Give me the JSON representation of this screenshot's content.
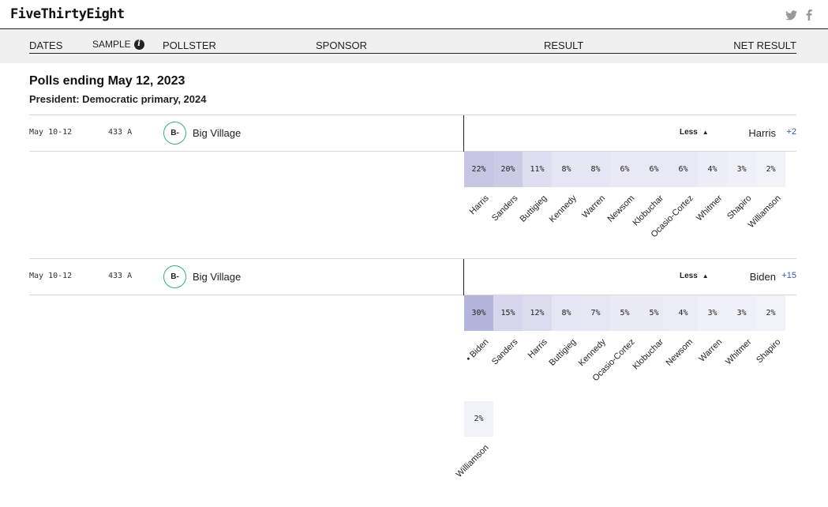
{
  "header": {
    "logo": "FiveThirtyEight",
    "social": [
      {
        "name": "twitter",
        "icon": "twitter-icon"
      },
      {
        "name": "facebook",
        "icon": "facebook-icon"
      }
    ]
  },
  "columns": {
    "dates": "DATES",
    "sample": "SAMPLE",
    "sample_info_icon": "info-icon",
    "pollster": "POLLSTER",
    "sponsor": "SPONSOR",
    "result": "RESULT",
    "net_result": "NET RESULT"
  },
  "group": {
    "title": "Polls ending May 12, 2023",
    "subtitle": "President: Democratic primary, 2024"
  },
  "colors": {
    "grade_ring": "#3aaa8c",
    "net_margin": "#3b55b9",
    "band": "#f0f0f0"
  },
  "polls": [
    {
      "dates": "May 10-12",
      "sample": "433 A",
      "grade": "B-",
      "pollster": "Big Village",
      "toggle": "Less",
      "leader": "Harris",
      "margin": "+2",
      "results": [
        {
          "name": "Harris",
          "pct": "22%",
          "value": 22
        },
        {
          "name": "Sanders",
          "pct": "20%",
          "value": 20
        },
        {
          "name": "Buttigieg",
          "pct": "11%",
          "value": 11
        },
        {
          "name": "Kennedy",
          "pct": "8%",
          "value": 8
        },
        {
          "name": "Warren",
          "pct": "8%",
          "value": 8
        },
        {
          "name": "Newsom",
          "pct": "6%",
          "value": 6
        },
        {
          "name": "Klobuchar",
          "pct": "6%",
          "value": 6
        },
        {
          "name": "Ocasio-Cortez",
          "pct": "6%",
          "value": 6
        },
        {
          "name": "Whitmer",
          "pct": "4%",
          "value": 4
        },
        {
          "name": "Shapiro",
          "pct": "3%",
          "value": 3
        },
        {
          "name": "Williamson",
          "pct": "2%",
          "value": 2
        }
      ]
    },
    {
      "dates": "May 10-12",
      "sample": "433 A",
      "grade": "B-",
      "pollster": "Big Village",
      "toggle": "Less",
      "leader": "Biden",
      "margin": "+15",
      "results": [
        {
          "name": "Biden",
          "pct": "30%",
          "value": 30,
          "leader": true
        },
        {
          "name": "Sanders",
          "pct": "15%",
          "value": 15
        },
        {
          "name": "Harris",
          "pct": "12%",
          "value": 12
        },
        {
          "name": "Buttigieg",
          "pct": "8%",
          "value": 8
        },
        {
          "name": "Kennedy",
          "pct": "7%",
          "value": 7
        },
        {
          "name": "Ocasio-Cortez",
          "pct": "5%",
          "value": 5
        },
        {
          "name": "Klobuchar",
          "pct": "5%",
          "value": 5
        },
        {
          "name": "Newsom",
          "pct": "4%",
          "value": 4
        },
        {
          "name": "Warren",
          "pct": "3%",
          "value": 3
        },
        {
          "name": "Whitmer",
          "pct": "3%",
          "value": 3
        },
        {
          "name": "Shapiro",
          "pct": "2%",
          "value": 2
        }
      ],
      "overflow": [
        {
          "name": "Williamson",
          "pct": "2%",
          "value": 2
        }
      ]
    }
  ]
}
